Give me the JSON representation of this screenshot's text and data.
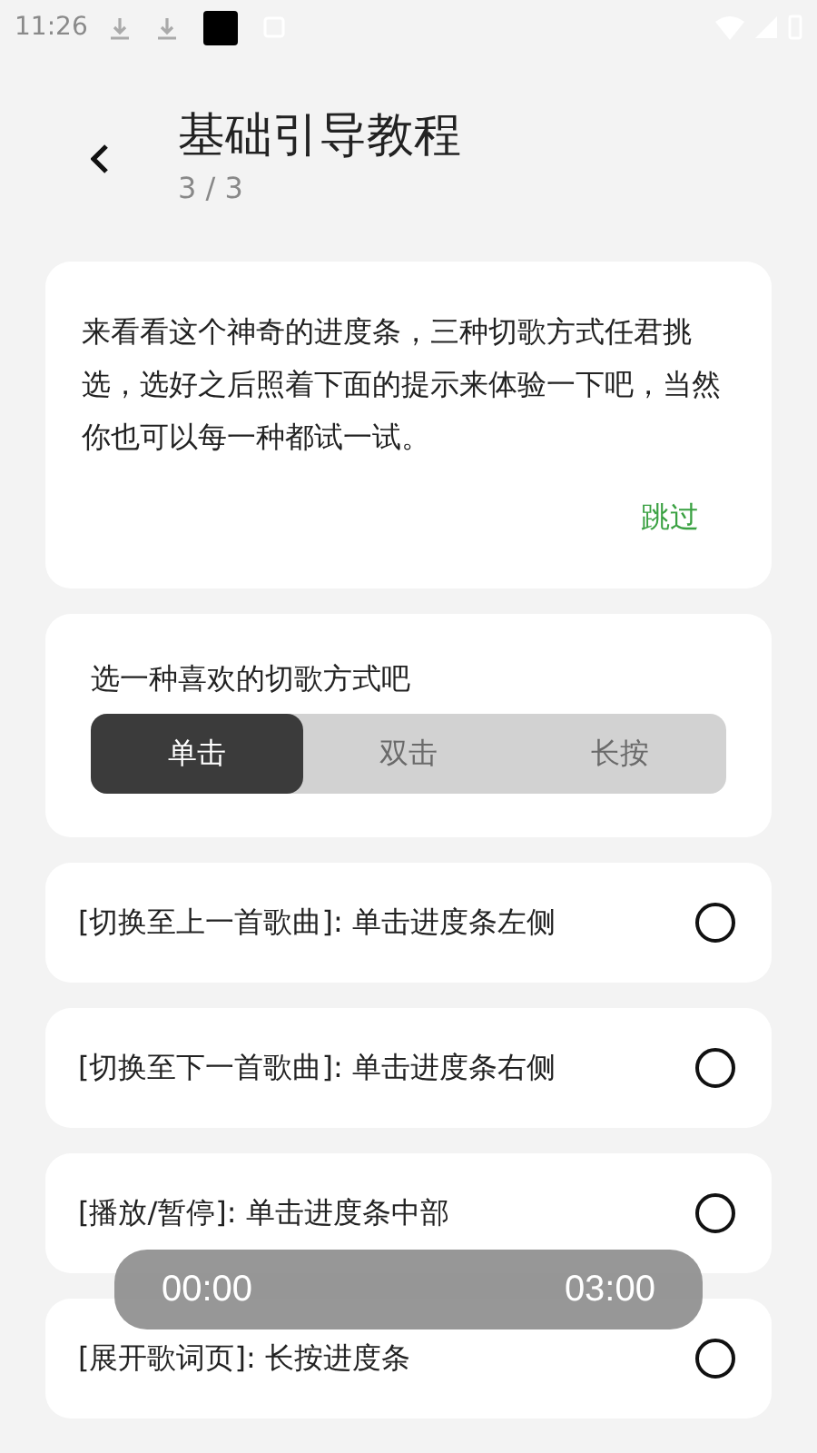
{
  "status_bar": {
    "time": "11:26"
  },
  "header": {
    "title": "基础引导教程",
    "step": "3 / 3"
  },
  "intro": {
    "text": "来看看这个神奇的进度条，三种切歌方式任君挑选，选好之后照着下面的提示来体验一下吧，当然你也可以每一种都试一试。",
    "skip": "跳过"
  },
  "mode_picker": {
    "label": "选一种喜欢的切歌方式吧",
    "options": [
      {
        "label": "单击",
        "selected": true
      },
      {
        "label": "双击",
        "selected": false
      },
      {
        "label": "长按",
        "selected": false
      }
    ]
  },
  "gestures": [
    {
      "text": "[切换至上一首歌曲]: 单击进度条左侧",
      "checked": false
    },
    {
      "text": "[切换至下一首歌曲]: 单击进度条右侧",
      "checked": false
    },
    {
      "text": "[播放/暂停]: 单击进度条中部",
      "checked": false
    },
    {
      "text": "[展开歌词页]: 长按进度条",
      "checked": false
    }
  ],
  "progress_overlay": {
    "elapsed": "00:00",
    "total": "03:00"
  }
}
